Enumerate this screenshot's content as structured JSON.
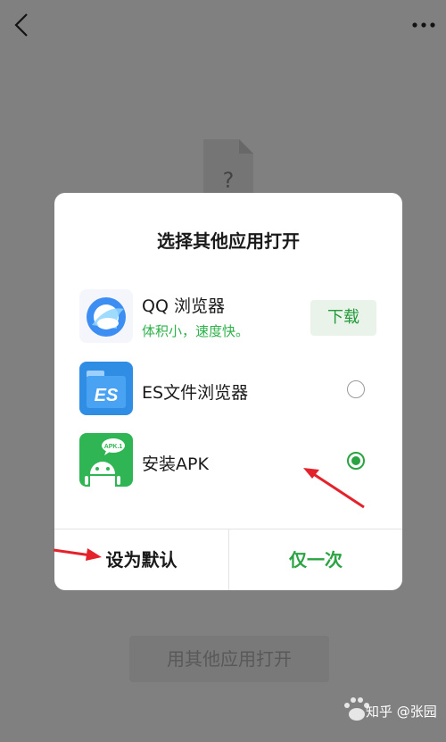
{
  "header": {
    "back_icon": "chevron-left-icon",
    "more_icon": "more-dots-icon"
  },
  "background": {
    "file_icon": "unknown-file-icon",
    "file_mark": "?",
    "open_other_label": "用其他应用打开"
  },
  "dialog": {
    "title": "选择其他应用打开",
    "apps": [
      {
        "name": "QQ 浏览器",
        "subtitle": "体积小，速度快。",
        "action": "下载",
        "icon": "qq-browser-icon"
      },
      {
        "name": "ES文件浏览器",
        "icon": "es-file-explorer-icon",
        "selected": false
      },
      {
        "name": "安装APK",
        "badge": "APK.1",
        "icon": "android-apk-icon",
        "selected": true
      }
    ],
    "set_default_label": "设为默认",
    "just_once_label": "仅一次"
  },
  "watermark": {
    "text": "知乎 @张园"
  },
  "colors": {
    "accent_green": "#2aa343",
    "annotation_red": "#e4222b"
  }
}
